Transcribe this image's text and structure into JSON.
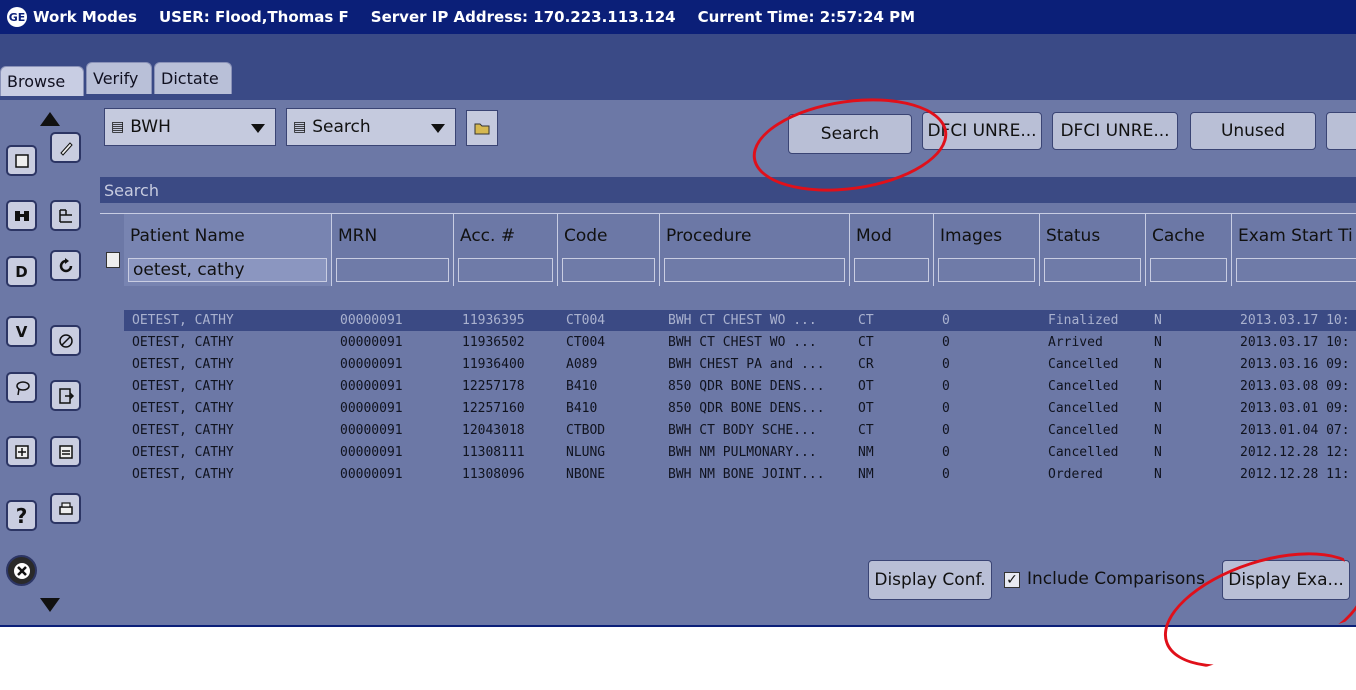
{
  "titlebar": {
    "app": "Work Modes",
    "user": "USER: Flood,Thomas F",
    "server": "Server IP Address: 170.223.113.124",
    "time": "Current Time: 2:57:24 PM"
  },
  "tabs": [
    "Browse",
    "Verify",
    "Dictate"
  ],
  "toolbar": {
    "site_select": "BWH",
    "mode_select": "Search",
    "search_button": "Search",
    "preset1": "DFCI UNRE...",
    "preset2": "DFCI UNRE...",
    "preset3": "Unused"
  },
  "search_strip_label": "Search",
  "columns": [
    "Patient Name",
    "MRN",
    "Acc. #",
    "Code",
    "Procedure",
    "Mod",
    "Images",
    "Status",
    "Cache",
    "Exam Start Ti"
  ],
  "filter_patient_name": "oetest, cathy",
  "rows": [
    [
      "OETEST, CATHY",
      "00000091",
      "11936395",
      "CT004",
      "BWH CT CHEST WO ...",
      "CT",
      "0",
      "Finalized",
      "N",
      "2013.03.17 10:"
    ],
    [
      "OETEST, CATHY",
      "00000091",
      "11936502",
      "CT004",
      "BWH CT CHEST WO ...",
      "CT",
      "0",
      "Arrived",
      "N",
      "2013.03.17 10:"
    ],
    [
      "OETEST, CATHY",
      "00000091",
      "11936400",
      "A089",
      "BWH CHEST PA and ...",
      "CR",
      "0",
      "Cancelled",
      "N",
      "2013.03.16 09:"
    ],
    [
      "OETEST, CATHY",
      "00000091",
      "12257178",
      "B410",
      "850 QDR BONE DENS...",
      "OT",
      "0",
      "Cancelled",
      "N",
      "2013.03.08 09:"
    ],
    [
      "OETEST, CATHY",
      "00000091",
      "12257160",
      "B410",
      "850 QDR BONE DENS...",
      "OT",
      "0",
      "Cancelled",
      "N",
      "2013.03.01 09:"
    ],
    [
      "OETEST, CATHY",
      "00000091",
      "12043018",
      "CTBOD",
      "BWH CT BODY SCHE...",
      "CT",
      "0",
      "Cancelled",
      "N",
      "2013.01.04 07:"
    ],
    [
      "OETEST, CATHY",
      "00000091",
      "11308111",
      "NLUNG",
      "BWH NM PULMONARY...",
      "NM",
      "0",
      "Cancelled",
      "N",
      "2012.12.28 12:"
    ],
    [
      "OETEST, CATHY",
      "00000091",
      "11308096",
      "NBONE",
      "BWH NM BONE JOINT...",
      "NM",
      "0",
      "Ordered",
      "N",
      "2012.12.28 11:"
    ]
  ],
  "bottom": {
    "display_conf": "Display Conf.",
    "include_comparisons": "Include Comparisons",
    "display_exam": "Display Exa..."
  },
  "tools_left": [
    "D",
    "V",
    "?"
  ],
  "annotation_color": "#e0101a"
}
